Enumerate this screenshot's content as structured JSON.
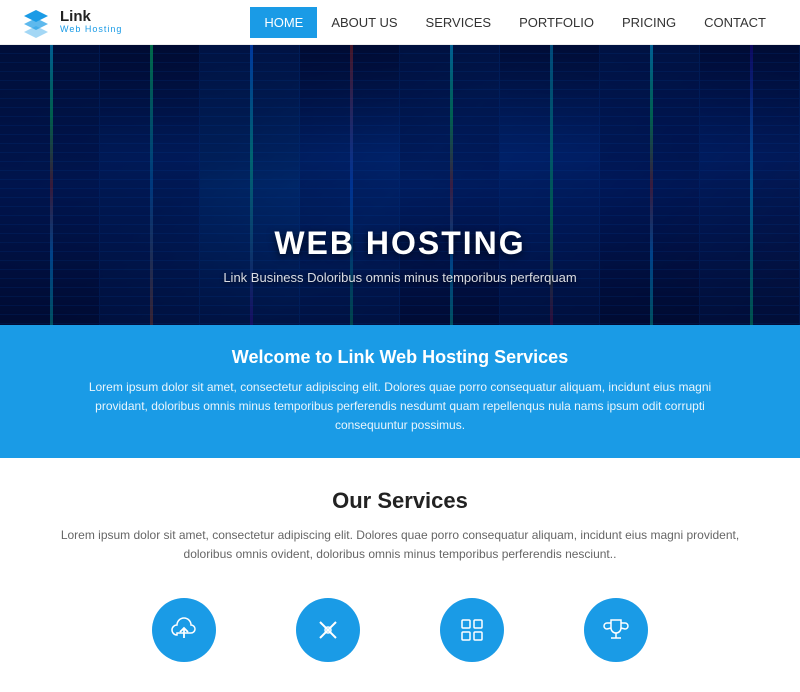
{
  "header": {
    "logo_link": "Link",
    "logo_sub": "Web Hosting",
    "nav": [
      {
        "label": "HOME",
        "active": true
      },
      {
        "label": "ABOUT US",
        "active": false
      },
      {
        "label": "SERVICES",
        "active": false
      },
      {
        "label": "PORTFOLIO",
        "active": false
      },
      {
        "label": "PRICING",
        "active": false
      },
      {
        "label": "CONTACT",
        "active": false
      }
    ]
  },
  "hero": {
    "title": "WEB HOSTING",
    "subtitle": "Link Business Doloribus omnis minus temporibus perferquam"
  },
  "blue_band": {
    "title": "Welcome to Link Web Hosting Services",
    "text": "Lorem ipsum dolor sit amet, consectetur adipiscing elit. Dolores quae porro consequatur aliquam, incidunt eius magni providant, doloribus omnis minus temporibus perferendis nesdumt quam repellenqus nula nams ipsum odit corrupti consequuntur possimus."
  },
  "services": {
    "title": "Our Services",
    "text": "Lorem ipsum dolor sit amet, consectetur adipiscing elit. Dolores quae porro consequatur aliquam, incidunt eius magni provident, doloribus omnis ovident, doloribus omnis minus temporibus perferendis nesciunt..",
    "icons": [
      {
        "name": "cloud-upload",
        "label": ""
      },
      {
        "name": "wrench-cross",
        "label": ""
      },
      {
        "name": "grid-layout",
        "label": ""
      },
      {
        "name": "trophy",
        "label": ""
      }
    ]
  }
}
